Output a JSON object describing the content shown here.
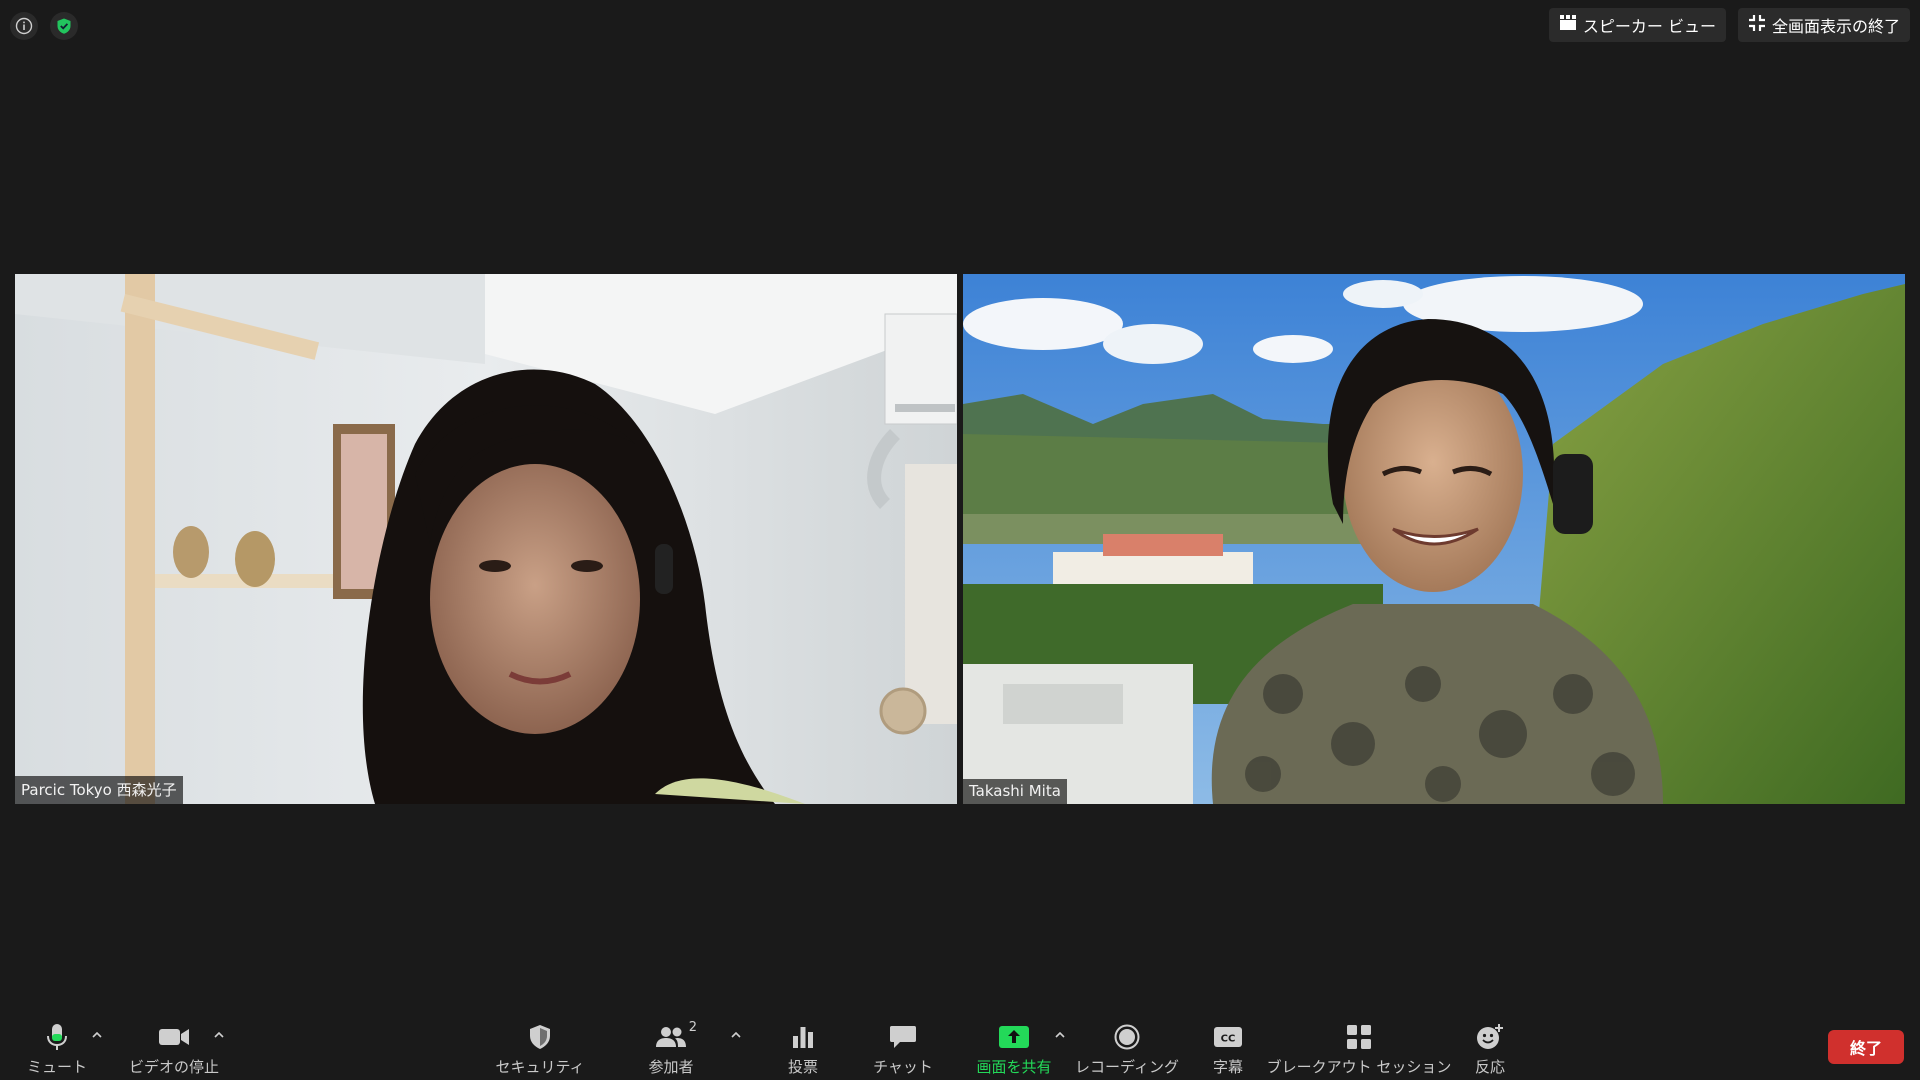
{
  "window": {
    "top_buttons": {
      "speaker_view": "スピーカー ビュー",
      "exit_fullscreen": "全画面表示の終了"
    }
  },
  "participants": [
    {
      "name": "Parcic Tokyo 西森光子"
    },
    {
      "name": "Takashi Mita"
    }
  ],
  "toolbar": {
    "mute": "ミュート",
    "stop_video": "ビデオの停止",
    "security": "セキュリティ",
    "participants": "参加者",
    "participants_count": "2",
    "polls": "投票",
    "chat": "チャット",
    "share_screen": "画面を共有",
    "recording": "レコーディング",
    "captions": "字幕",
    "breakout": "ブレークアウト セッション",
    "reactions": "反応",
    "end": "終了"
  },
  "colors": {
    "background": "#1a1a1a",
    "share_accent": "#23d959",
    "end_red": "#d0302d",
    "shield_green": "#22c55e"
  }
}
